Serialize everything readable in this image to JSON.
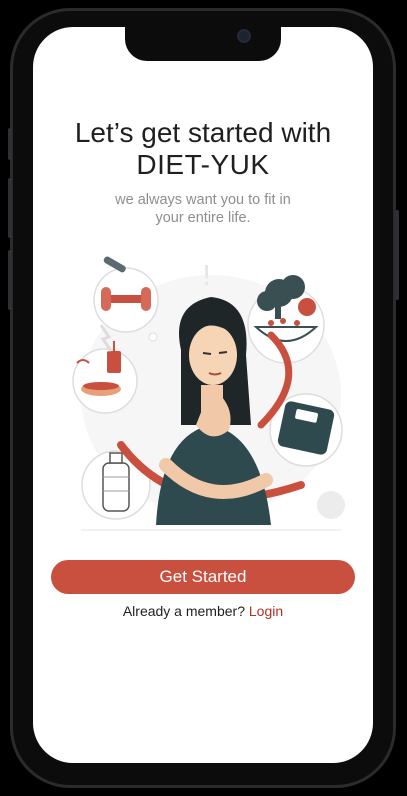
{
  "title_line1": "Let’s get started with",
  "title_line2": "DIET-YUK",
  "subtitle_line1": "we always want you to fit in",
  "subtitle_line2": "your entire life.",
  "cta_label": "Get Started",
  "member_prompt": "Already a member?",
  "login_label": "Login",
  "illustration_icon": "dieting-woman-illustration",
  "colors": {
    "accent": "#c9503f",
    "login": "#b23228",
    "title": "#1f1f1f",
    "subtitle": "#8e8e8e",
    "illustration_dark": "#2f4a4f"
  }
}
